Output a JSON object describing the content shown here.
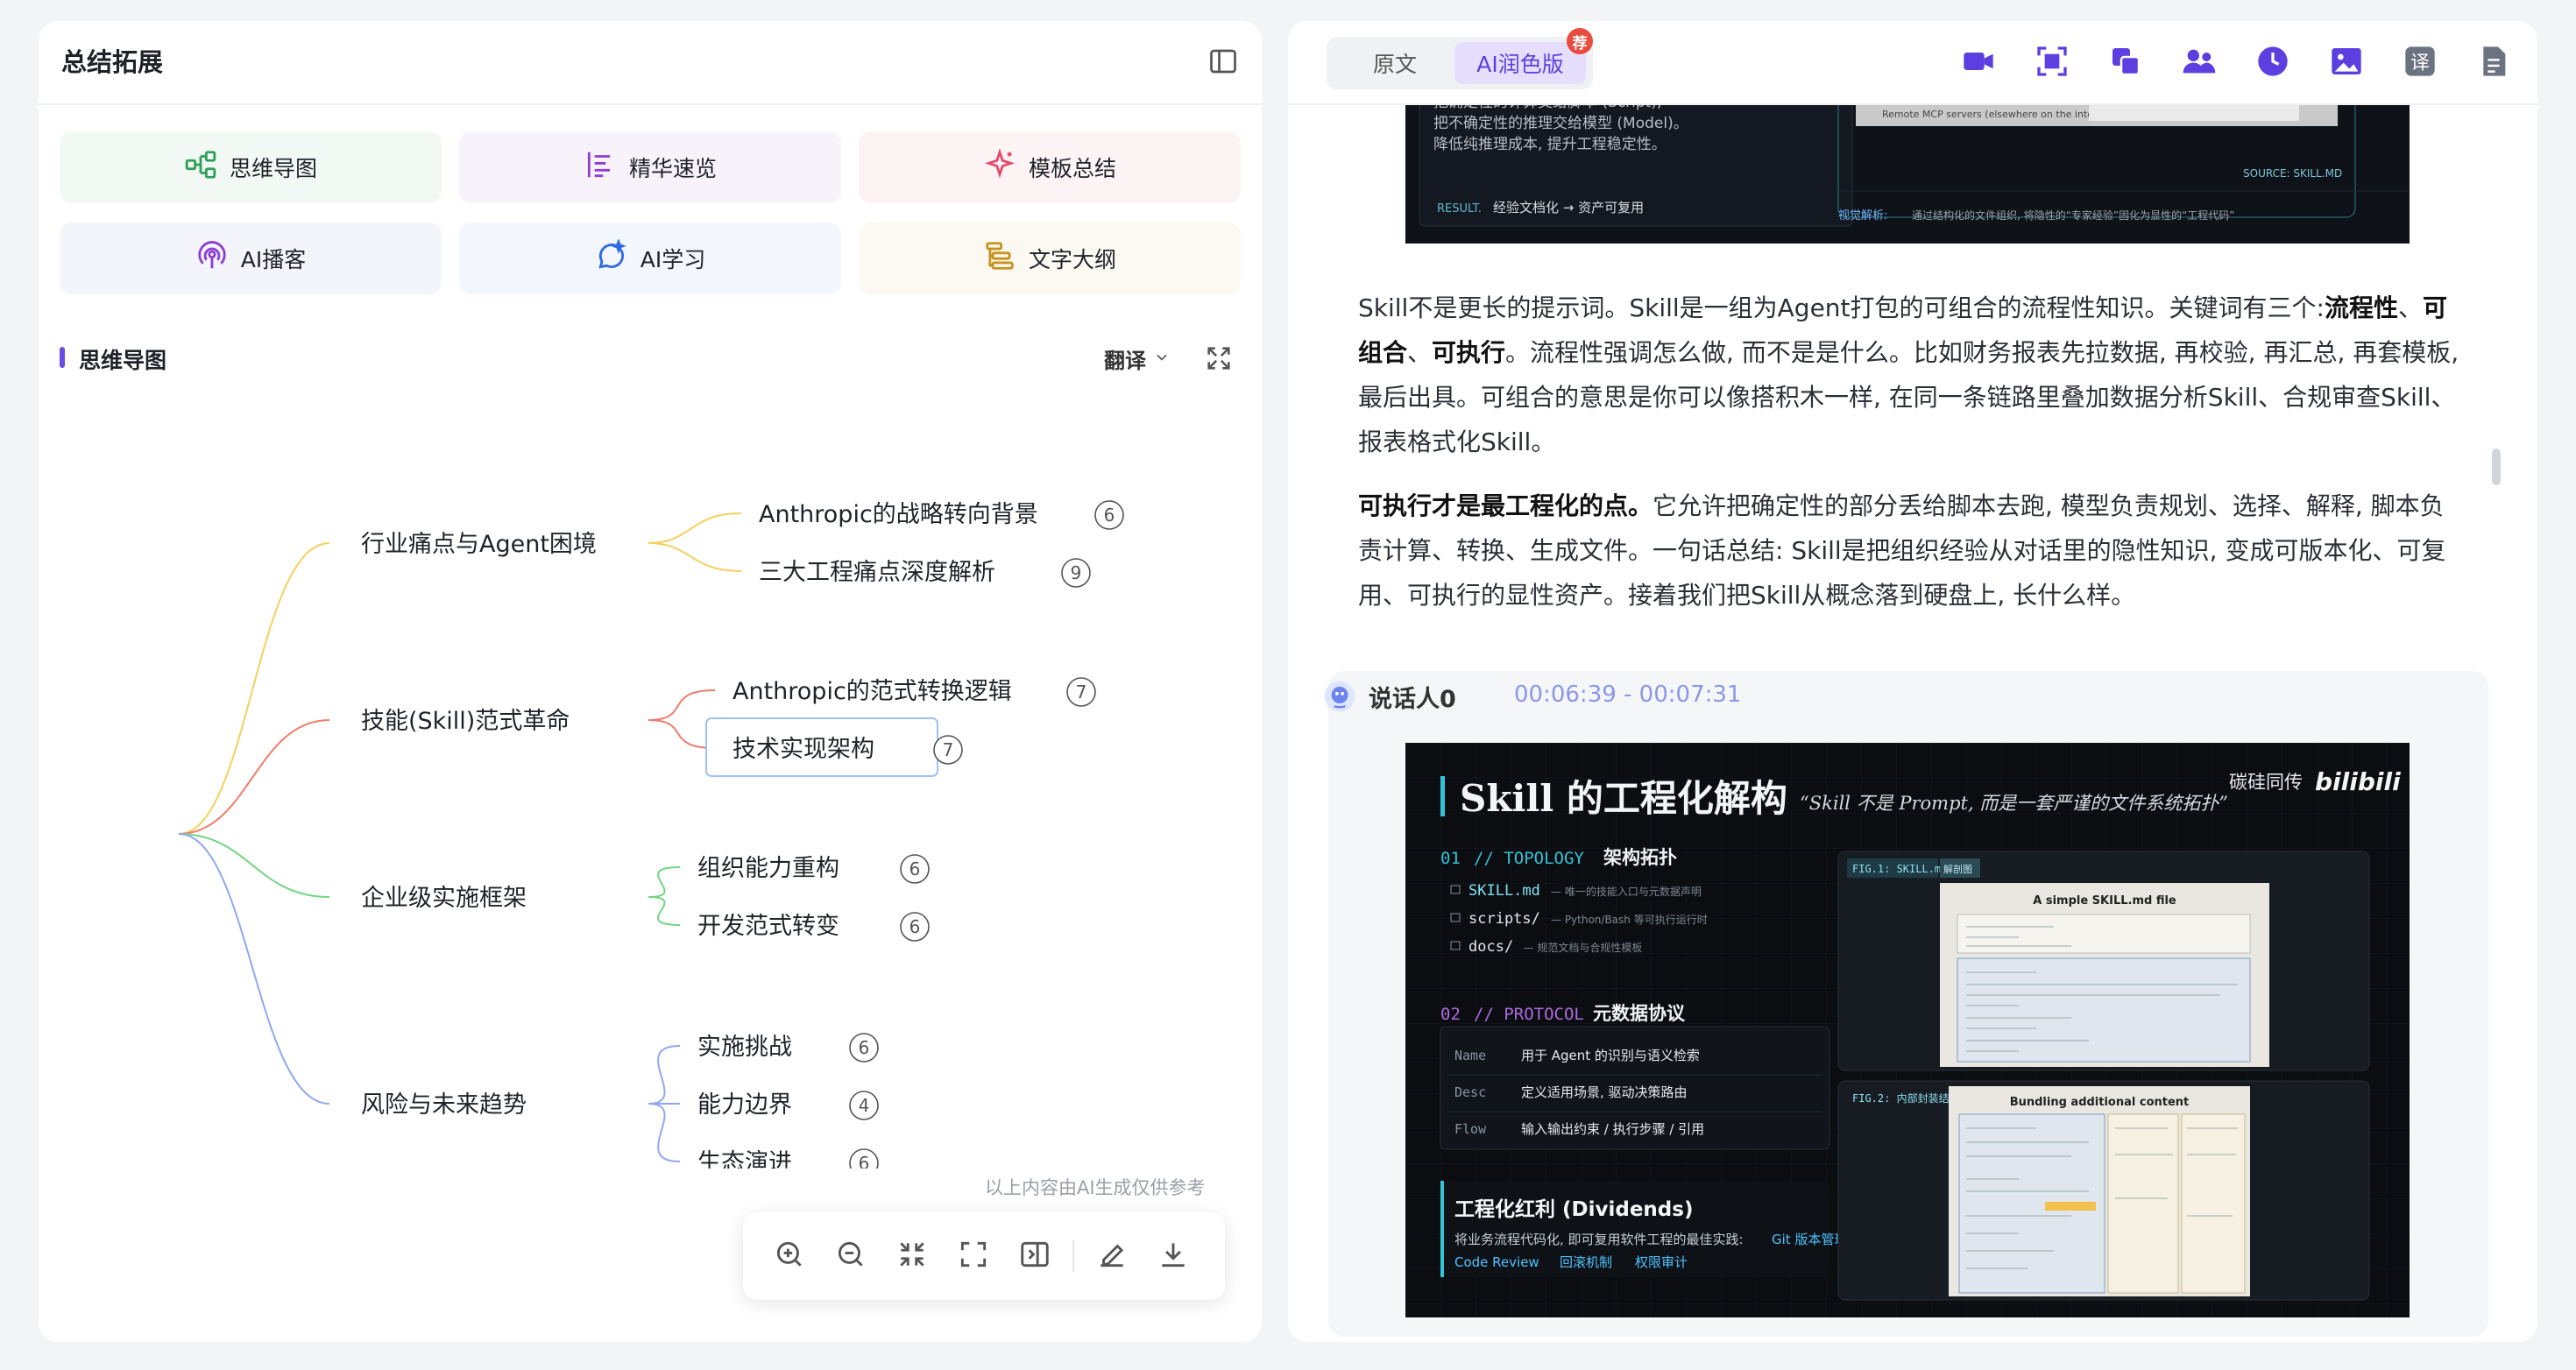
{
  "left": {
    "title": "总结拓展",
    "tools": [
      {
        "label": "思维导图",
        "icon": "mindmap-icon",
        "bg": "#f2f8f4",
        "color": "#2f9e59"
      },
      {
        "label": "精华速览",
        "icon": "summary-list-icon",
        "bg": "#f8f2fa",
        "color": "#8d3fd1"
      },
      {
        "label": "模板总结",
        "icon": "sparkle-icon",
        "bg": "#fcf3f5",
        "color": "#e34c6c"
      },
      {
        "label": "AI播客",
        "icon": "podcast-icon",
        "bg": "#f4f5fb",
        "color": "#8d3fd1"
      },
      {
        "label": "AI学习",
        "icon": "chat-sparkle-icon",
        "bg": "#f3f6fc",
        "color": "#2f6be0"
      },
      {
        "label": "文字大纲",
        "icon": "outline-icon",
        "bg": "#fbf9f1",
        "color": "#c79420"
      }
    ],
    "section_title": "思维导图",
    "translate_label": "翻译",
    "mindmap": {
      "branches": [
        {
          "label": "行业痛点与Agent困境",
          "color": "#f6cf5c",
          "children": [
            {
              "label": "Anthropic的战略转向背景",
              "count": "6"
            },
            {
              "label": "三大工程痛点深度解析",
              "count": "9"
            }
          ]
        },
        {
          "label": "技能(Skill)范式革命",
          "color": "#f07b6b",
          "children": [
            {
              "label": "Anthropic的范式转换逻辑",
              "count": "7"
            },
            {
              "label": "技术实现架构",
              "count": "7"
            }
          ]
        },
        {
          "label": "企业级实施框架",
          "color": "#72d67f",
          "children": [
            {
              "label": "组织能力重构",
              "count": "6"
            },
            {
              "label": "开发范式转变",
              "count": "6"
            }
          ]
        },
        {
          "label": "风险与未来趋势",
          "color": "#8fa8f2",
          "children": [
            {
              "label": "实施挑战",
              "count": "6"
            },
            {
              "label": "能力边界",
              "count": "4"
            },
            {
              "label": "生态演进",
              "count": "6"
            }
          ]
        }
      ]
    },
    "disclaimer": "以上内容由AI生成仅供参考",
    "toolbar_icons": [
      "zoom-in-icon",
      "zoom-out-icon",
      "collapse-icon",
      "fit-screen-icon",
      "split-view-icon",
      "edit-icon",
      "download-icon"
    ]
  },
  "right": {
    "tab_original": "原文",
    "tab_ai": "AI润色版",
    "recommend_badge": "荐",
    "header_icons": [
      "video-icon",
      "screenshot-icon",
      "copy-icon",
      "speakers-icon",
      "clock-icon",
      "image-icon",
      "translate-icon",
      "document-icon"
    ],
    "slide1": {
      "lines": [
        "把确定性的计算交给脚本 (Script),",
        "把不确定性的推理交给模型 (Model)。",
        "降低纯推理成本, 提升工程稳定性。"
      ],
      "result_label": "RESULT.",
      "result_text": "经验文档化 → 资产可复用",
      "caption_strong": "视觉解析:",
      "caption_text": "通过结构化的文件组织, 将隐性的“专家经验”固化为显性的“工程代码”",
      "source": "SOURCE: SKILL.MD",
      "remote": "Remote MCP servers (elsewhere on the internet)"
    },
    "paragraphs": [
      {
        "segments": [
          {
            "t": "Skill不是更长的提示词。Skill是一组为Agent打包的可组合的流程性知识。关键词有三个:",
            "b": false
          },
          {
            "t": "流程性",
            "b": true
          },
          {
            "t": "、",
            "b": false
          },
          {
            "t": "可组合",
            "b": true
          },
          {
            "t": "、",
            "b": false
          },
          {
            "t": "可执行",
            "b": true
          },
          {
            "t": "。流程性强调怎么做, 而不是是什么。比如财务报表先拉数据, 再校验, 再汇总, 再套模板, 最后出具。可组合的意思是你可以像搭积木一样, 在同一条链路里叠加数据分析Skill、合规审查Skill、报表格式化Skill。",
            "b": false
          }
        ]
      },
      {
        "segments": [
          {
            "t": "可执行才是最工程化的点。",
            "b": true
          },
          {
            "t": "它允许把确定性的部分丢给脚本去跑, 模型负责规划、选择、解释, 脚本负责计算、转换、生成文件。一句话总结: Skill是把组织经验从对话里的隐性知识, 变成可版本化、可复用、可执行的显性资产。接着我们把Skill从概念落到硬盘上, 长什么样。",
            "b": false
          }
        ]
      }
    ],
    "speaker": {
      "name": "说话人0",
      "time": "00:06:39 - 00:07:31"
    },
    "slide2": {
      "title": "Skill 的工程化解构",
      "quote": "“Skill 不是 Prompt, 而是一套严谨的文件系统拓扑”",
      "brand": "碳硅同传",
      "logo": "bilibili",
      "s1_num": "01",
      "s1_code": "// TOPOLOGY",
      "s1_title": "架构拓扑",
      "files": [
        {
          "name": "SKILL.md",
          "desc": "— 唯一的技能入口与元数据声明"
        },
        {
          "name": "scripts/",
          "desc": "— Python/Bash 等可执行运行时"
        },
        {
          "name": "docs/",
          "desc": "— 规范文档与合规性模板"
        }
      ],
      "s2_num": "02",
      "s2_code": "// PROTOCOL",
      "s2_title": "元数据协议",
      "protocol": [
        {
          "k": "Name",
          "v": "用于 Agent 的识别与语义检索"
        },
        {
          "k": "Desc",
          "v": "定义适用场景, 驱动决策路由"
        },
        {
          "k": "Flow",
          "v": "输入输出约束 / 执行步骤 / 引用"
        }
      ],
      "dividends_title": "工程化红利 (Dividends)",
      "dividends_text1": "将业务流程代码化, 即可复用软件工程的最佳实践:",
      "dividends_hl1": "Git 版本管理",
      "dividends_hl2": "Code Review",
      "dividends_hl3": "回滚机制",
      "dividends_hl4": "权限审计",
      "fig1_tag": "FIG.1: SKILL.md",
      "fig1_tag2": "解剖图",
      "fig1_title": "A simple SKILL.md file",
      "fig2_tag": "FIG.2: 内部封装结构",
      "fig2_title": "Bundling additional content"
    }
  }
}
